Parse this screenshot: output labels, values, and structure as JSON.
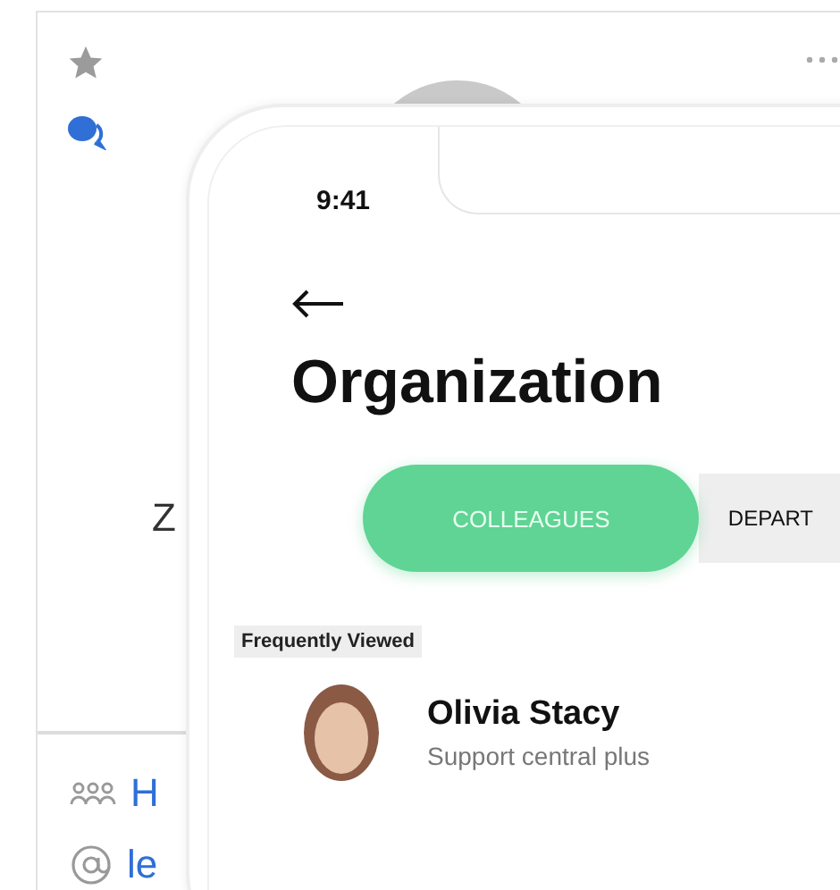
{
  "profile_card": {
    "name_fragment": "Z",
    "contact_rows": [
      {
        "kind": "group",
        "text": "H"
      },
      {
        "kind": "email",
        "text": "le"
      }
    ]
  },
  "phone": {
    "status_time": "9:41",
    "title": "Organization",
    "tabs": [
      {
        "label": "COLLEAGUES",
        "selected": true
      },
      {
        "label": "DEPART",
        "selected": false
      }
    ],
    "section_label": "Frequently Viewed",
    "people": [
      {
        "name": "Olivia Stacy",
        "subtitle": "Support central plus"
      }
    ]
  }
}
